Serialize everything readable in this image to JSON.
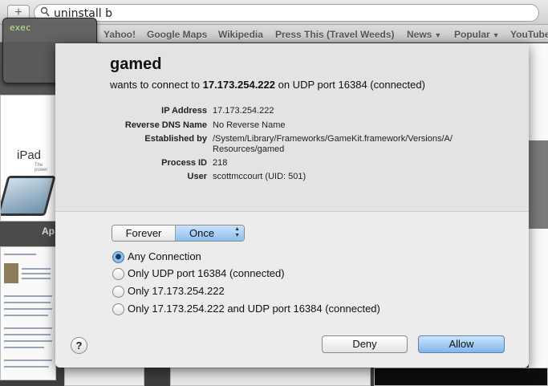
{
  "browser": {
    "url_text": "uninstall b",
    "new_tab_glyph": "+",
    "bookmarks": [
      {
        "label": "Yahoo!",
        "menu": false
      },
      {
        "label": "Google Maps",
        "menu": false
      },
      {
        "label": "Wikipedia",
        "menu": false
      },
      {
        "label": "Press This (Travel Weeds)",
        "menu": false
      },
      {
        "label": "News",
        "menu": true
      },
      {
        "label": "Popular",
        "menu": true
      },
      {
        "label": "YouTube",
        "menu": false
      }
    ],
    "menu_arrow": "▼",
    "thumb_ipad_text": "iPad",
    "thumb_ipad_sub": "The power",
    "thumb_label": "Ap"
  },
  "hud": {
    "title": "exec",
    "accent": "#b9e88a"
  },
  "dialog": {
    "app_name": "gamed",
    "connect_prefix": "wants to connect to ",
    "connect_ip": "17.173.254.222",
    "connect_suffix": " on UDP port 16384 (connected)",
    "info": {
      "ip_label": "IP Address",
      "ip_value": "17.173.254.222",
      "dns_label": "Reverse DNS Name",
      "dns_value": "No Reverse Name",
      "est_label": "Established by",
      "est_value_1": "/System/Library/Frameworks/GameKit.framework/Versions/A/",
      "est_value_2": "Resources/gamed",
      "pid_label": "Process ID",
      "pid_value": "218",
      "user_label": "User",
      "user_value": "scottmccourt (UID: 501)"
    },
    "duration": {
      "options": [
        "Forever",
        "Once"
      ],
      "selected": "Once"
    },
    "scope": {
      "selected_index": 0,
      "options": [
        "Any Connection",
        "Only UDP port 16384 (connected)",
        "Only 17.173.254.222",
        "Only 17.173.254.222 and UDP port 16384 (connected)"
      ]
    },
    "help_label": "?",
    "deny_label": "Deny",
    "allow_label": "Allow",
    "accent_color": "#8dc0ee"
  }
}
